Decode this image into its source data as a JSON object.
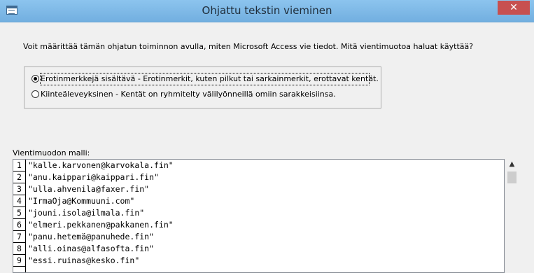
{
  "window": {
    "title": "Ohjattu tekstin vieminen",
    "close_glyph": "✕"
  },
  "prompt": "Voit määrittää tämän ohjatun toiminnon avulla, miten Microsoft Access vie tiedot. Mitä vientimuotoa haluat käyttää?",
  "format_options": [
    {
      "label": "Erotinmerkkejä sisältävä - Erotinmerkit, kuten pilkut tai sarkainmerkit, erottavat kentät.",
      "selected": true
    },
    {
      "label": "Kiinteäleveyksinen - Kentät on ryhmitelty välilyönneillä omiin sarakkeisiinsa.",
      "selected": false
    }
  ],
  "preview": {
    "label": "Vientimuodon malli:",
    "rows": [
      {
        "num": "1",
        "text": "\"kalle.karvonen@karvokala.fin\""
      },
      {
        "num": "2",
        "text": "\"anu.kaippari@kaippari.fin\""
      },
      {
        "num": "3",
        "text": "\"ulla.ahvenila@faxer.fin\""
      },
      {
        "num": "4",
        "text": "\"IrmaOja@Kommuuni.com\""
      },
      {
        "num": "5",
        "text": "\"jouni.isola@ilmala.fin\""
      },
      {
        "num": "6",
        "text": "\"elmeri.pekkanen@pakkanen.fin\""
      },
      {
        "num": "7",
        "text": "\"panu.hetemä@panuhede.fin\""
      },
      {
        "num": "8",
        "text": "\"alli.oinas@alfasofta.fin\""
      },
      {
        "num": "9",
        "text": "\"essi.ruinas@kesko.fin\""
      },
      {
        "num": "",
        "text": ""
      }
    ]
  },
  "scrollbar": {
    "up_glyph": "▲"
  }
}
